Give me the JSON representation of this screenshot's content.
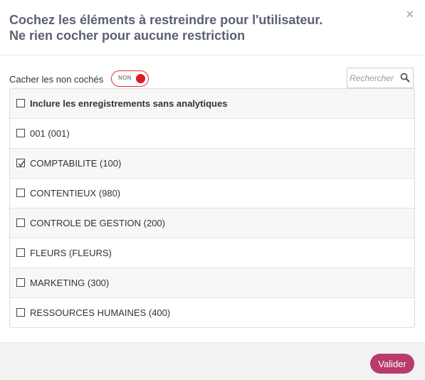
{
  "header": {
    "title_line1": "Cochez les éléments à restreindre pour l'utilisateur.",
    "title_line2": "Ne rien cocher pour aucune restriction",
    "close_symbol": "×"
  },
  "toolbar": {
    "hide_unchecked_label": "Cacher les non cochés",
    "toggle_text": "NON",
    "toggle_color": "#e01a22"
  },
  "search": {
    "placeholder": "Rechercher",
    "icon": "search-icon"
  },
  "items": [
    {
      "label": "Inclure les enregistrements sans analytiques",
      "checked": false,
      "bold": true
    },
    {
      "label": "001 (001)",
      "checked": false,
      "bold": false
    },
    {
      "label": "COMPTABILITE (100)",
      "checked": true,
      "bold": false
    },
    {
      "label": "CONTENTIEUX (980)",
      "checked": false,
      "bold": false
    },
    {
      "label": "CONTROLE DE GESTION (200)",
      "checked": false,
      "bold": false
    },
    {
      "label": "FLEURS (FLEURS)",
      "checked": false,
      "bold": false
    },
    {
      "label": "MARKETING (300)",
      "checked": false,
      "bold": false
    },
    {
      "label": "RESSOURCES HUMAINES (400)",
      "checked": false,
      "bold": false
    }
  ],
  "footer": {
    "validate_label": "Valider",
    "accent_color": "#b83c6a"
  }
}
